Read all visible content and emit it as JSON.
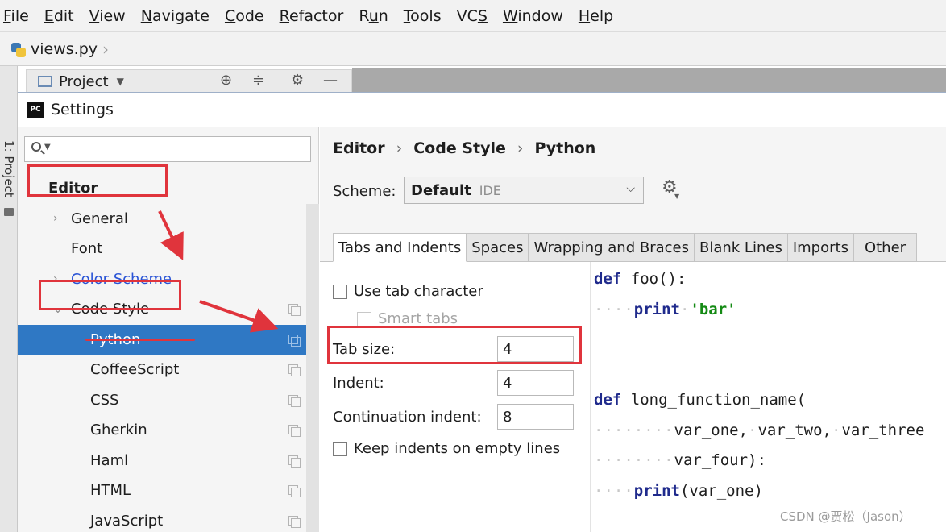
{
  "menubar": {
    "items": [
      {
        "u": "F",
        "rest": "ile"
      },
      {
        "u": "E",
        "rest": "dit"
      },
      {
        "u": "V",
        "rest": "iew"
      },
      {
        "u": "N",
        "rest": "avigate"
      },
      {
        "u": "C",
        "rest": "ode"
      },
      {
        "u": "R",
        "rest": "efactor"
      },
      {
        "u": "",
        "pre": "R",
        "u2": "u",
        "rest": "n"
      },
      {
        "u": "T",
        "rest": "ools"
      },
      {
        "u": "",
        "pre": "VC",
        "u2": "S",
        "rest": ""
      },
      {
        "u": "W",
        "rest": "indow"
      },
      {
        "u": "H",
        "rest": "elp"
      }
    ]
  },
  "navbar": {
    "file": "views.py"
  },
  "toolstrip": {
    "label": "1: Project"
  },
  "project_panel": {
    "title": "Project"
  },
  "dialog": {
    "title": "Settings",
    "logo": "PC"
  },
  "left_nav": {
    "search_placeholder": "",
    "items": [
      {
        "label": "Editor",
        "level": 0,
        "chevron": "",
        "bold": true
      },
      {
        "label": "General",
        "level": 1,
        "chevron": "›"
      },
      {
        "label": "Font",
        "level": 1,
        "chevron": ""
      },
      {
        "label": "Color Scheme",
        "level": 1,
        "chevron": "›",
        "color": "#2a54d6"
      },
      {
        "label": "Code Style",
        "level": 1,
        "chevron": "⌄",
        "copy": true
      },
      {
        "label": "Python",
        "level": 2,
        "chevron": "",
        "copy": true,
        "selected": true
      },
      {
        "label": "CoffeeScript",
        "level": 2,
        "chevron": "",
        "copy": true
      },
      {
        "label": "CSS",
        "level": 2,
        "chevron": "",
        "copy": true
      },
      {
        "label": "Gherkin",
        "level": 2,
        "chevron": "",
        "copy": true
      },
      {
        "label": "Haml",
        "level": 2,
        "chevron": "",
        "copy": true
      },
      {
        "label": "HTML",
        "level": 2,
        "chevron": "",
        "copy": true
      },
      {
        "label": "JavaScript",
        "level": 2,
        "chevron": "",
        "copy": true
      }
    ]
  },
  "content": {
    "breadcrumb": [
      "Editor",
      "Code Style",
      "Python"
    ],
    "breadcrumb_sep": "›",
    "scheme": {
      "label": "Scheme:",
      "value": "Default",
      "hint": "IDE"
    },
    "tabs": [
      "Tabs and Indents",
      "Spaces",
      "Wrapping and Braces",
      "Blank Lines",
      "Imports",
      "Other"
    ],
    "options": {
      "use_tab_character": {
        "label": "Use tab character",
        "checked": false
      },
      "smart_tabs": {
        "label": "Smart tabs",
        "checked": false,
        "disabled": true
      },
      "tab_size": {
        "label": "Tab size:",
        "value": "4"
      },
      "indent": {
        "label": "Indent:",
        "value": "4"
      },
      "continuation_indent": {
        "label": "Continuation indent:",
        "value": "8"
      },
      "keep_indents": {
        "label": "Keep indents on empty lines",
        "checked": false
      }
    },
    "code_preview": [
      [
        {
          "t": "def",
          "c": "kw"
        },
        {
          "t": " foo():",
          "c": ""
        }
      ],
      [
        {
          "t": "····",
          "c": "ws"
        },
        {
          "t": "print",
          "c": "kw"
        },
        {
          "t": "·",
          "c": "ws"
        },
        {
          "t": "'bar'",
          "c": "str"
        }
      ],
      [],
      [],
      [
        {
          "t": "def",
          "c": "kw"
        },
        {
          "t": " long_function_name(",
          "c": ""
        }
      ],
      [
        {
          "t": "········",
          "c": "ws"
        },
        {
          "t": "var_one,",
          "c": ""
        },
        {
          "t": "·",
          "c": "ws"
        },
        {
          "t": "var_two,",
          "c": ""
        },
        {
          "t": "·",
          "c": "ws"
        },
        {
          "t": "var_three",
          "c": ""
        }
      ],
      [
        {
          "t": "········",
          "c": "ws"
        },
        {
          "t": "var_four):",
          "c": ""
        }
      ],
      [
        {
          "t": "····",
          "c": "ws"
        },
        {
          "t": "print",
          "c": "kw"
        },
        {
          "t": "(var_one)",
          "c": ""
        }
      ]
    ]
  },
  "watermark": "CSDN @贾松（Jason）",
  "colors": {
    "accent": "#2f78c4",
    "annotation": "#e0343c",
    "link": "#2a54d6"
  }
}
